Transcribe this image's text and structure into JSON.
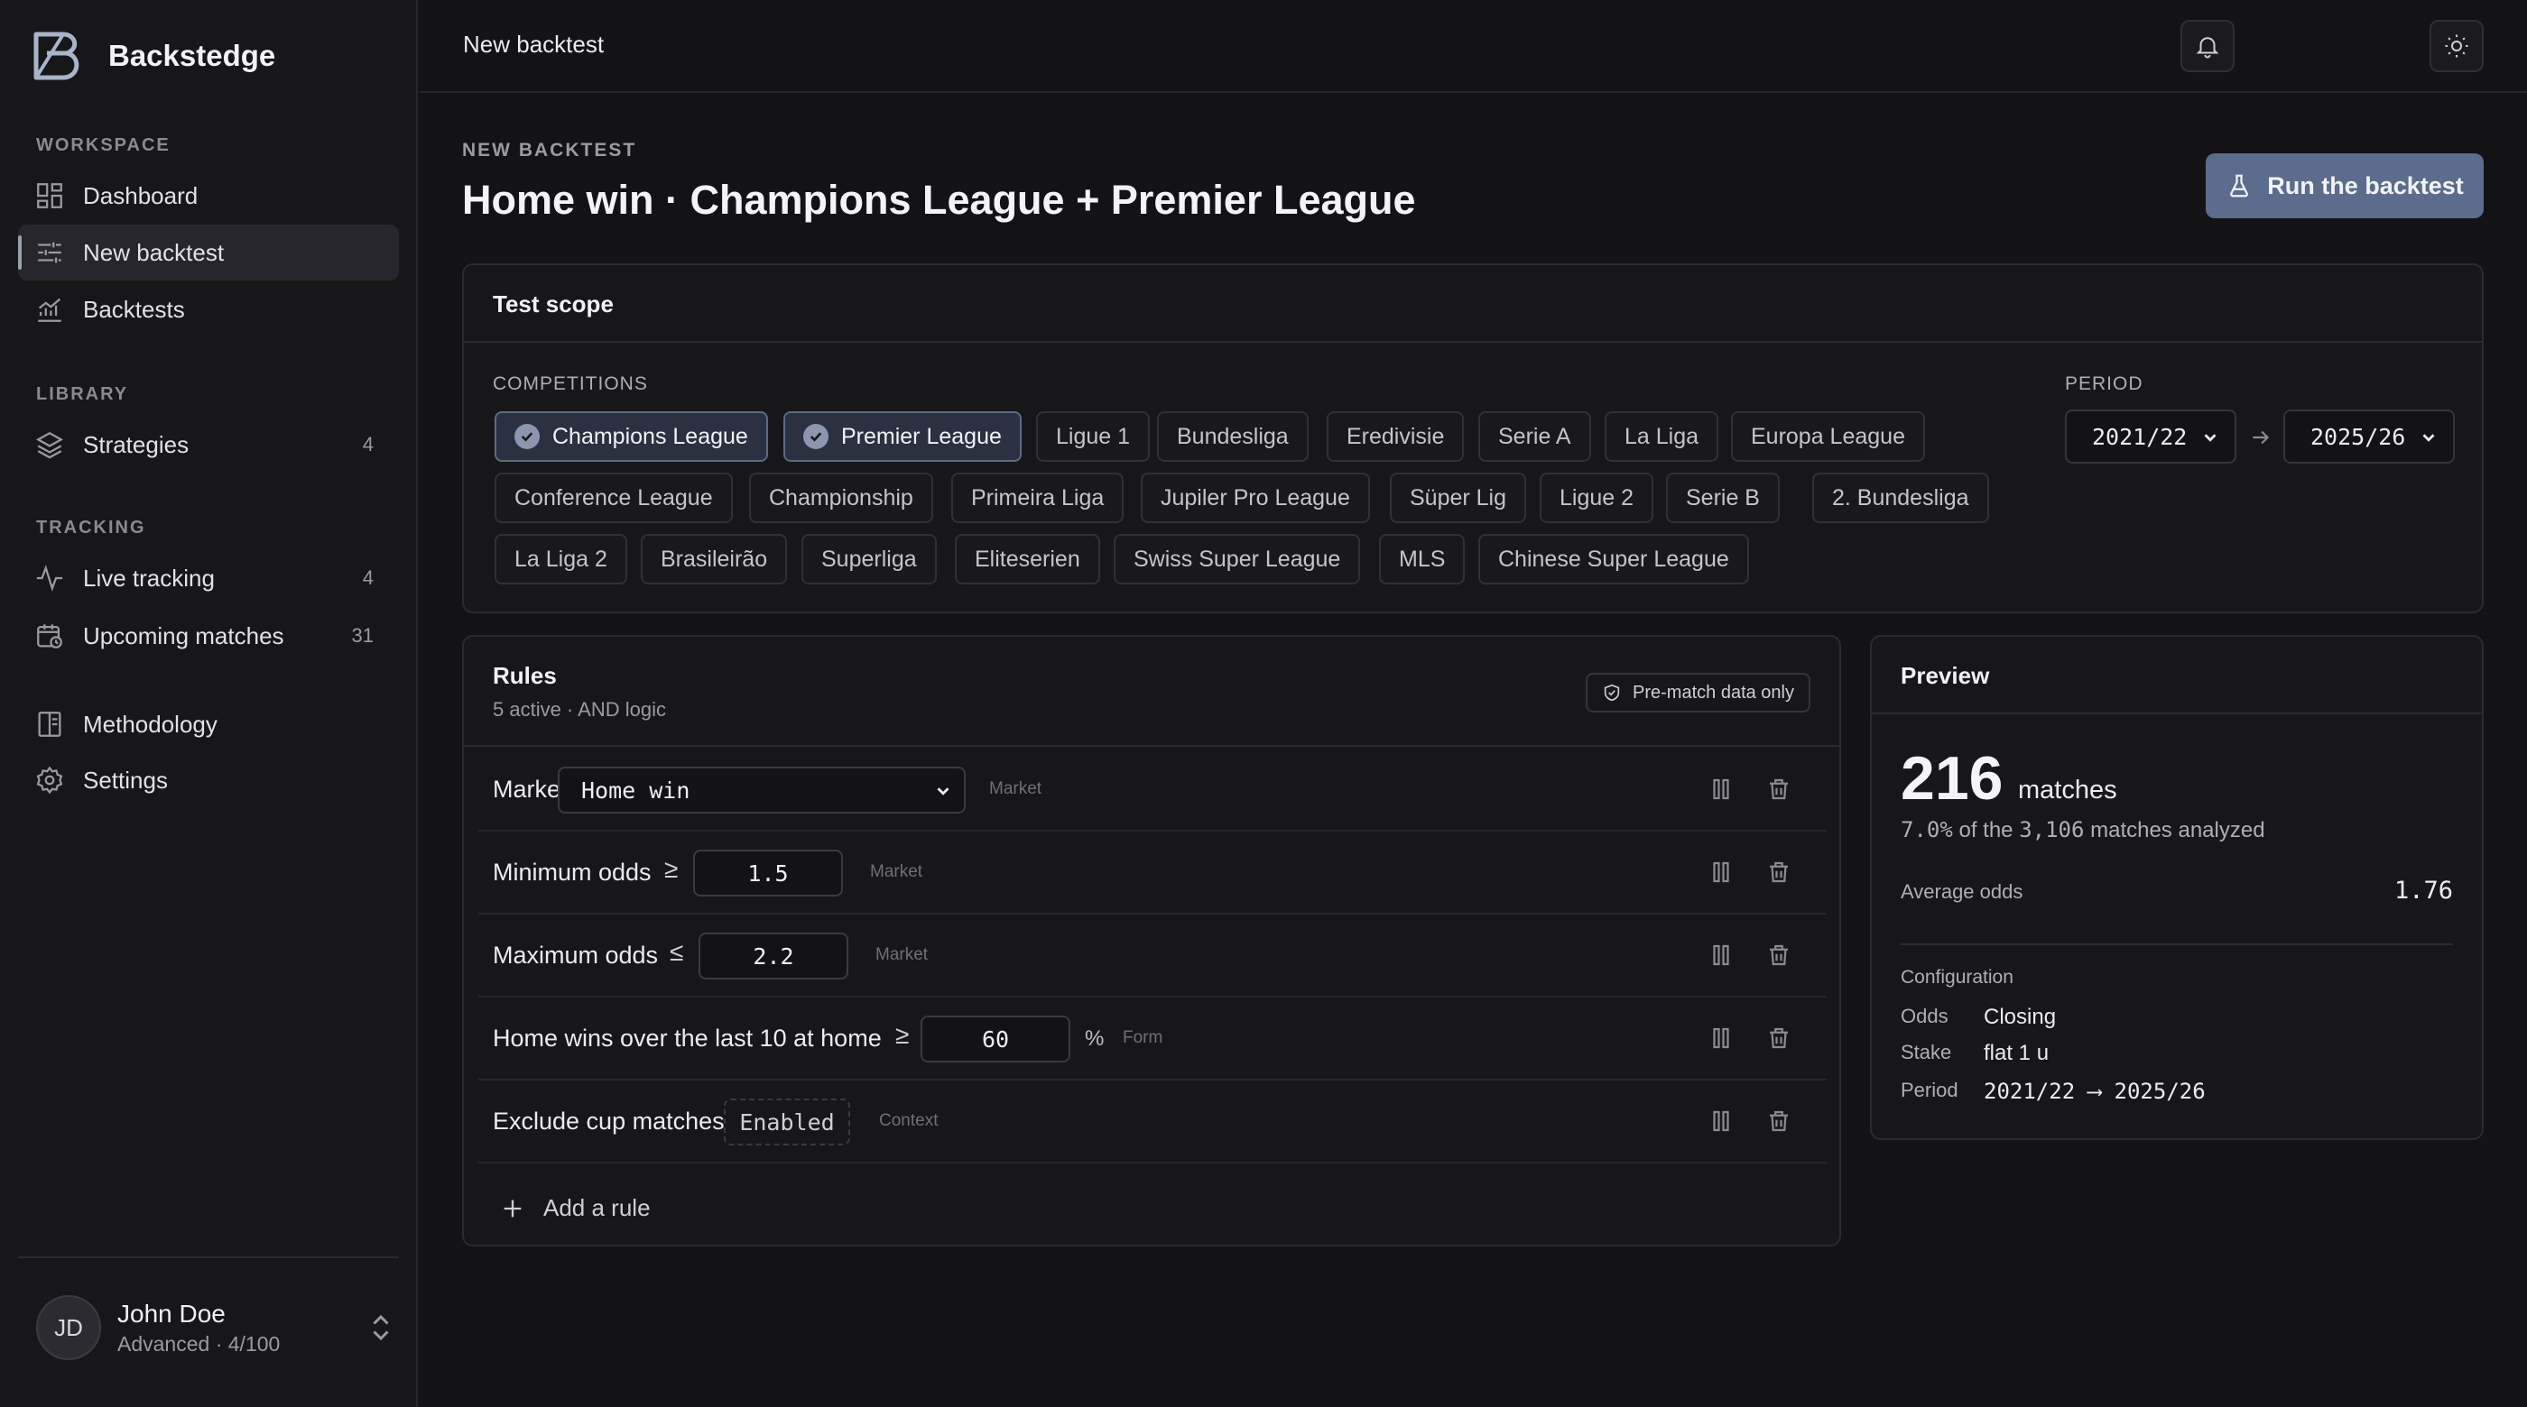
{
  "app": {
    "name": "Backstedge"
  },
  "sidebar": {
    "sections": {
      "workspace": "WORKSPACE",
      "library": "LIBRARY",
      "tracking": "TRACKING"
    },
    "items": [
      {
        "label": "Dashboard",
        "icon": "grid-icon"
      },
      {
        "label": "New backtest",
        "icon": "sliders-icon",
        "active": true
      },
      {
        "label": "Backtests",
        "icon": "chart-icon"
      },
      {
        "label": "Strategies",
        "icon": "layers-icon",
        "count": "4"
      },
      {
        "label": "Live tracking",
        "icon": "activity-icon",
        "count": "4"
      },
      {
        "label": "Upcoming matches",
        "icon": "calendar-clock-icon",
        "count": "31"
      },
      {
        "label": "Methodology",
        "icon": "book-icon"
      },
      {
        "label": "Settings",
        "icon": "gear-icon"
      }
    ],
    "user": {
      "initials": "JD",
      "name": "John Doe",
      "subtitle": "Advanced · 4/100"
    }
  },
  "header": {
    "title": "New backtest"
  },
  "page": {
    "eyebrow": "NEW BACKTEST",
    "title": "Home win · Champions League + Premier League",
    "run_button": "Run the backtest"
  },
  "scope": {
    "title": "Test scope",
    "competitions_label": "COMPETITIONS",
    "competitions": [
      {
        "label": "Champions League",
        "selected": true
      },
      {
        "label": "Premier League",
        "selected": true
      },
      {
        "label": "Ligue 1"
      },
      {
        "label": "Bundesliga"
      },
      {
        "label": "Eredivisie"
      },
      {
        "label": "Serie A"
      },
      {
        "label": "La Liga"
      },
      {
        "label": "Europa League"
      },
      {
        "label": "Conference League"
      },
      {
        "label": "Championship"
      },
      {
        "label": "Primeira Liga"
      },
      {
        "label": "Jupiler Pro League"
      },
      {
        "label": "Süper Lig"
      },
      {
        "label": "Ligue 2"
      },
      {
        "label": "Serie B"
      },
      {
        "label": "2. Bundesliga"
      },
      {
        "label": "La Liga 2"
      },
      {
        "label": "Brasileirão"
      },
      {
        "label": "Superliga"
      },
      {
        "label": "Eliteserien"
      },
      {
        "label": "Swiss Super League"
      },
      {
        "label": "MLS"
      },
      {
        "label": "Chinese Super League"
      }
    ],
    "period_label": "PERIOD",
    "period_from": "2021/22",
    "period_to": "2025/26"
  },
  "rules": {
    "title": "Rules",
    "subtitle": "5 active · AND logic",
    "badge": "Pre-match data only",
    "market": {
      "label": "Market",
      "value": "Home win",
      "tag": "Market"
    },
    "min_odds": {
      "label": "Minimum odds",
      "op": "≥",
      "value": "1.5",
      "tag": "Market"
    },
    "max_odds": {
      "label": "Maximum odds",
      "op": "≤",
      "value": "2.2",
      "tag": "Market"
    },
    "home_wins": {
      "label": "Home wins over the last 10 at home",
      "op": "≥",
      "value": "60",
      "unit": "%",
      "tag": "Form"
    },
    "exclude_cup": {
      "label": "Exclude cup matches",
      "value": "Enabled",
      "tag": "Context"
    },
    "add_rule": "Add a rule"
  },
  "preview": {
    "title": "Preview",
    "matches": "216",
    "matches_unit": "matches",
    "pct": "7.0%",
    "pct_text_mid": " of the ",
    "analyzed_total": "3,106",
    "pct_text_end": " matches analyzed",
    "avg_odds_label": "Average odds",
    "avg_odds": "1.76",
    "config_label": "Configuration",
    "odds_label": "Odds",
    "odds_value": "Closing",
    "stake_label": "Stake",
    "stake_value": "flat 1 u",
    "period_label": "Period",
    "period_from": "2021/22",
    "period_arrow": "⟶",
    "period_to": "2025/26"
  },
  "colors": {
    "background": "#131315",
    "panel": "#17171a",
    "accent": "#5b6c8c",
    "chip_selected": "#2b3140"
  }
}
